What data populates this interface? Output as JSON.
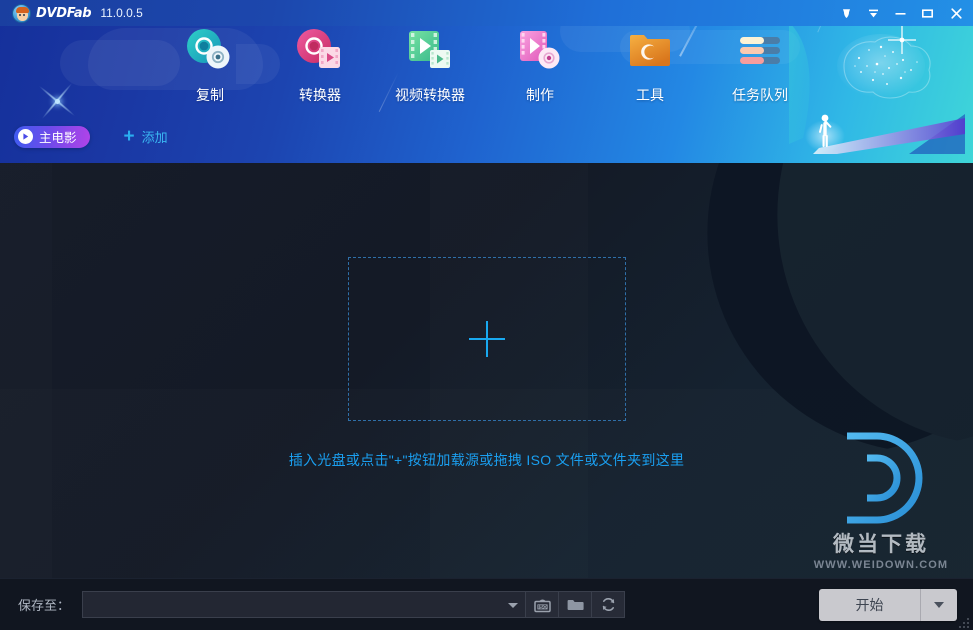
{
  "titlebar": {
    "app_name": "DVDFab",
    "version": "11.0.0.5",
    "logo_icon": "dvdfab-mascot-icon",
    "controls": [
      {
        "name": "account-icon",
        "glyph": "account"
      },
      {
        "name": "menu-dropdown-icon",
        "glyph": "chevron-down"
      },
      {
        "name": "minimize-icon",
        "glyph": "minimize"
      },
      {
        "name": "maximize-icon",
        "glyph": "maximize"
      },
      {
        "name": "close-icon",
        "glyph": "close"
      }
    ]
  },
  "nav": {
    "items": [
      {
        "label": "复制",
        "icon": "copy-disc-icon",
        "active": true
      },
      {
        "label": "转换器",
        "icon": "ripper-disc-icon",
        "active": false
      },
      {
        "label": "视频转换器",
        "icon": "video-converter-icon",
        "active": false
      },
      {
        "label": "制作",
        "icon": "creator-icon",
        "active": false
      },
      {
        "label": "工具",
        "icon": "tools-folder-icon",
        "active": false
      },
      {
        "label": "任务队列",
        "icon": "task-queue-icon",
        "active": false
      }
    ]
  },
  "subbar": {
    "mode_chip": {
      "label": "主电影",
      "icon": "play-circle-icon"
    },
    "add_button": {
      "label": "添加",
      "icon": "plus-icon"
    }
  },
  "main": {
    "dropzone": {
      "icon": "plus-large-icon"
    },
    "hint": "插入光盘或点击\"+\"按钮加载源或拖拽 ISO 文件或文件夹到这里"
  },
  "watermark": {
    "letter": "D",
    "site_cn": "微当下载",
    "site_url": "WWW.WEIDOWN.COM"
  },
  "bottombar": {
    "save_to_label": "保存至：",
    "path_value": "",
    "path_placeholder": "",
    "buttons": [
      {
        "name": "iso-output-button",
        "icon": "iso-icon"
      },
      {
        "name": "browse-folder-button",
        "icon": "folder-icon"
      },
      {
        "name": "refresh-button",
        "icon": "refresh-icon"
      }
    ],
    "start_button": {
      "label": "开始",
      "dropdown_icon": "chevron-down-icon"
    }
  },
  "colors": {
    "accent_blue": "#1a9ff0",
    "header_gradient_start": "#15309b",
    "header_gradient_end": "#3fd6d8",
    "chip_gradient_start": "#3f5cf0",
    "chip_gradient_end": "#b143e8",
    "content_bg": "#141a26",
    "bottom_bg": "#111620",
    "start_button_bg": "#c9c9ce"
  }
}
